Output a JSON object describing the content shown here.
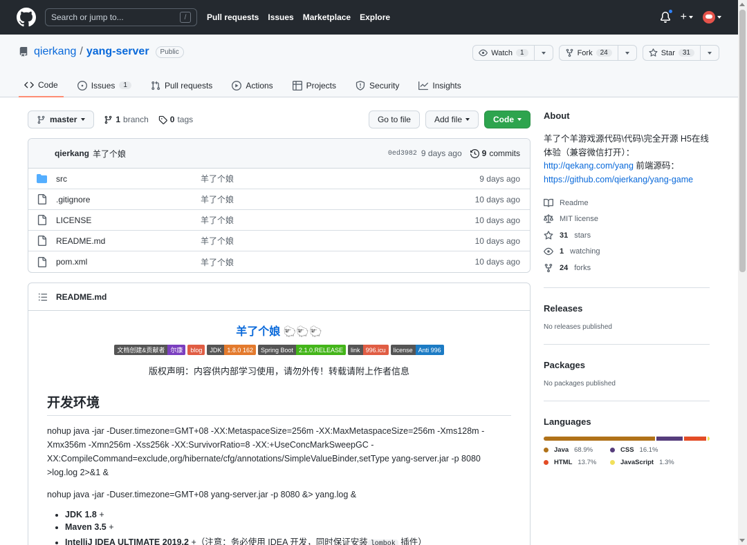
{
  "header": {
    "search_placeholder": "Search or jump to...",
    "slash_key": "/",
    "nav": [
      "Pull requests",
      "Issues",
      "Marketplace",
      "Explore"
    ],
    "plus_label": "+"
  },
  "repo": {
    "owner": "qierkang",
    "separator": "/",
    "name": "yang-server",
    "visibility": "Public",
    "watch": {
      "label": "Watch",
      "count": "1"
    },
    "fork": {
      "label": "Fork",
      "count": "24"
    },
    "star": {
      "label": "Star",
      "count": "31"
    }
  },
  "tabs": [
    {
      "label": "Code",
      "icon": "code-icon"
    },
    {
      "label": "Issues",
      "icon": "issue-icon",
      "count": "1"
    },
    {
      "label": "Pull requests",
      "icon": "pull-request-icon"
    },
    {
      "label": "Actions",
      "icon": "play-icon"
    },
    {
      "label": "Projects",
      "icon": "table-icon"
    },
    {
      "label": "Security",
      "icon": "shield-icon"
    },
    {
      "label": "Insights",
      "icon": "graph-icon"
    }
  ],
  "file_nav": {
    "branch": "master",
    "branches_count": "1",
    "branches_label": "branch",
    "tags_count": "0",
    "tags_label": "tags",
    "go_to_file": "Go to file",
    "add_file": "Add file",
    "code": "Code"
  },
  "commit": {
    "author": "qierkang",
    "message": "羊了个娘",
    "sha": "0ed3982",
    "age": "9 days ago",
    "commits_count": "9",
    "commits_label": "commits"
  },
  "files": [
    {
      "name": "src",
      "type": "folder",
      "message": "羊了个娘",
      "age": "9 days ago"
    },
    {
      "name": ".gitignore",
      "type": "file",
      "message": "羊了个娘",
      "age": "10 days ago"
    },
    {
      "name": "LICENSE",
      "type": "file",
      "message": "羊了个娘",
      "age": "10 days ago"
    },
    {
      "name": "README.md",
      "type": "file",
      "message": "羊了个娘",
      "age": "10 days ago"
    },
    {
      "name": "pom.xml",
      "type": "file",
      "message": "羊了个娘",
      "age": "10 days ago"
    }
  ],
  "readme": {
    "filename": "README.md",
    "title": "羊了个娘",
    "badges": [
      {
        "left": "文档创建&贡献者",
        "right": "尔康",
        "color": "#7b3fbf"
      },
      {
        "left": "",
        "right": "blog",
        "color": "#e05d44"
      },
      {
        "left": "JDK",
        "right": "1.8.0 162",
        "color": "#e37a2d"
      },
      {
        "left": "Spring Boot",
        "right": "2.1.0.RELEASE",
        "color": "#44b51a"
      },
      {
        "left": "link",
        "right": "996.icu",
        "color": "#e05d44"
      },
      {
        "left": "license",
        "right": "Anti 996",
        "color": "#1c7bc4"
      }
    ],
    "notice": "版权声明：内容供内部学习使用，请勿外传！转载请附上作者信息",
    "section_title": "开发环境",
    "cmd1": "nohup java -jar -Duser.timezone=GMT+08 -XX:MetaspaceSize=256m -XX:MaxMetaspaceSize=256m -Xms128m -Xmx356m -Xmn256m -Xss256k -XX:SurvivorRatio=8 -XX:+UseConcMarkSweepGC -XX:CompileCommand=exclude,org/hibernate/cfg/annotations/SimpleValueBinder,setType yang-server.jar -p 8080 >log.log 2>&1 &",
    "cmd2": "nohup java -jar -Duser.timezone=GMT+08 yang-server.jar -p 8080 &> yang.log &",
    "env": [
      {
        "label": "JDK 1.8",
        "suffix": " +"
      },
      {
        "label": "Maven 3.5",
        "suffix": " +"
      },
      {
        "label": "IntelliJ IDEA ULTIMATE 2019.2",
        "suffix": " +（注意：务必使用 IDEA 开发，同时保证安装",
        "code": "lombok",
        "tail": " 插件）"
      }
    ]
  },
  "sidebar": {
    "about_title": "About",
    "description": "羊了个羊游戏源代码\\代码\\完全开源 H5在线体验（兼容微信打开）：",
    "link1": "http://qekang.com/yang",
    "desc2": " 前端源码：",
    "link2": "https://github.com/qierkang/yang-game",
    "readme_label": "Readme",
    "license_label": "MIT license",
    "stars_count": "31",
    "stars_label": "stars",
    "watching_count": "1",
    "watching_label": "watching",
    "forks_count": "24",
    "forks_label": "forks",
    "releases_title": "Releases",
    "releases_empty": "No releases published",
    "packages_title": "Packages",
    "packages_empty": "No packages published",
    "languages_title": "Languages",
    "languages": [
      {
        "name": "Java",
        "pct": "68.9%",
        "value": 68.9,
        "color": "#b07219"
      },
      {
        "name": "CSS",
        "pct": "16.1%",
        "value": 16.1,
        "color": "#563d7c"
      },
      {
        "name": "HTML",
        "pct": "13.7%",
        "value": 13.7,
        "color": "#e34c26"
      },
      {
        "name": "JavaScript",
        "pct": "1.3%",
        "value": 1.3,
        "color": "#f1e05a"
      }
    ]
  }
}
